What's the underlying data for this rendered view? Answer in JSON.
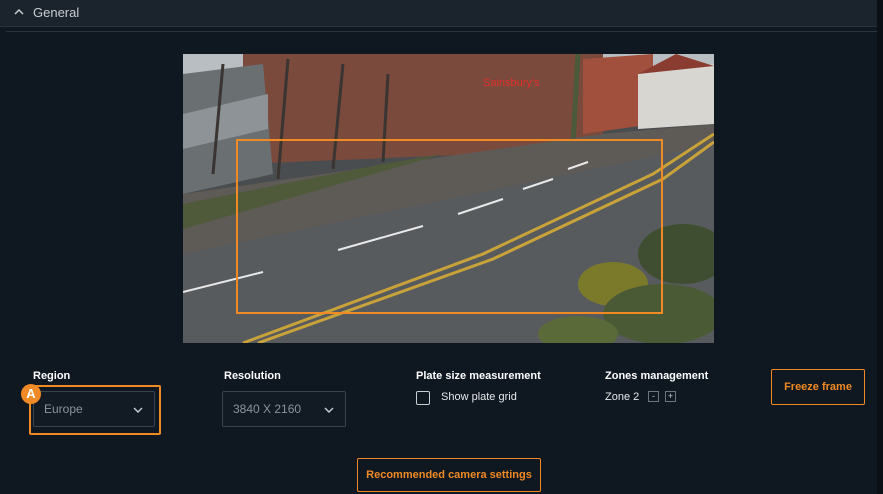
{
  "header": {
    "title": "General"
  },
  "region": {
    "label": "Region",
    "value": "Europe",
    "marker": "A"
  },
  "resolution": {
    "label": "Resolution",
    "value": "3840 X 2160"
  },
  "plate_size": {
    "label": "Plate size measurement",
    "checkbox_label": "Show plate grid",
    "checked": false
  },
  "zones": {
    "label": "Zones management",
    "current": "Zone 2",
    "minus": "-",
    "plus": "+"
  },
  "buttons": {
    "freeze": "Freeze frame",
    "recommended": "Recommended camera settings"
  },
  "camera": {
    "store_sign": "Sainsbury's"
  },
  "colors": {
    "accent": "#f08a24",
    "background": "#0f1720"
  }
}
